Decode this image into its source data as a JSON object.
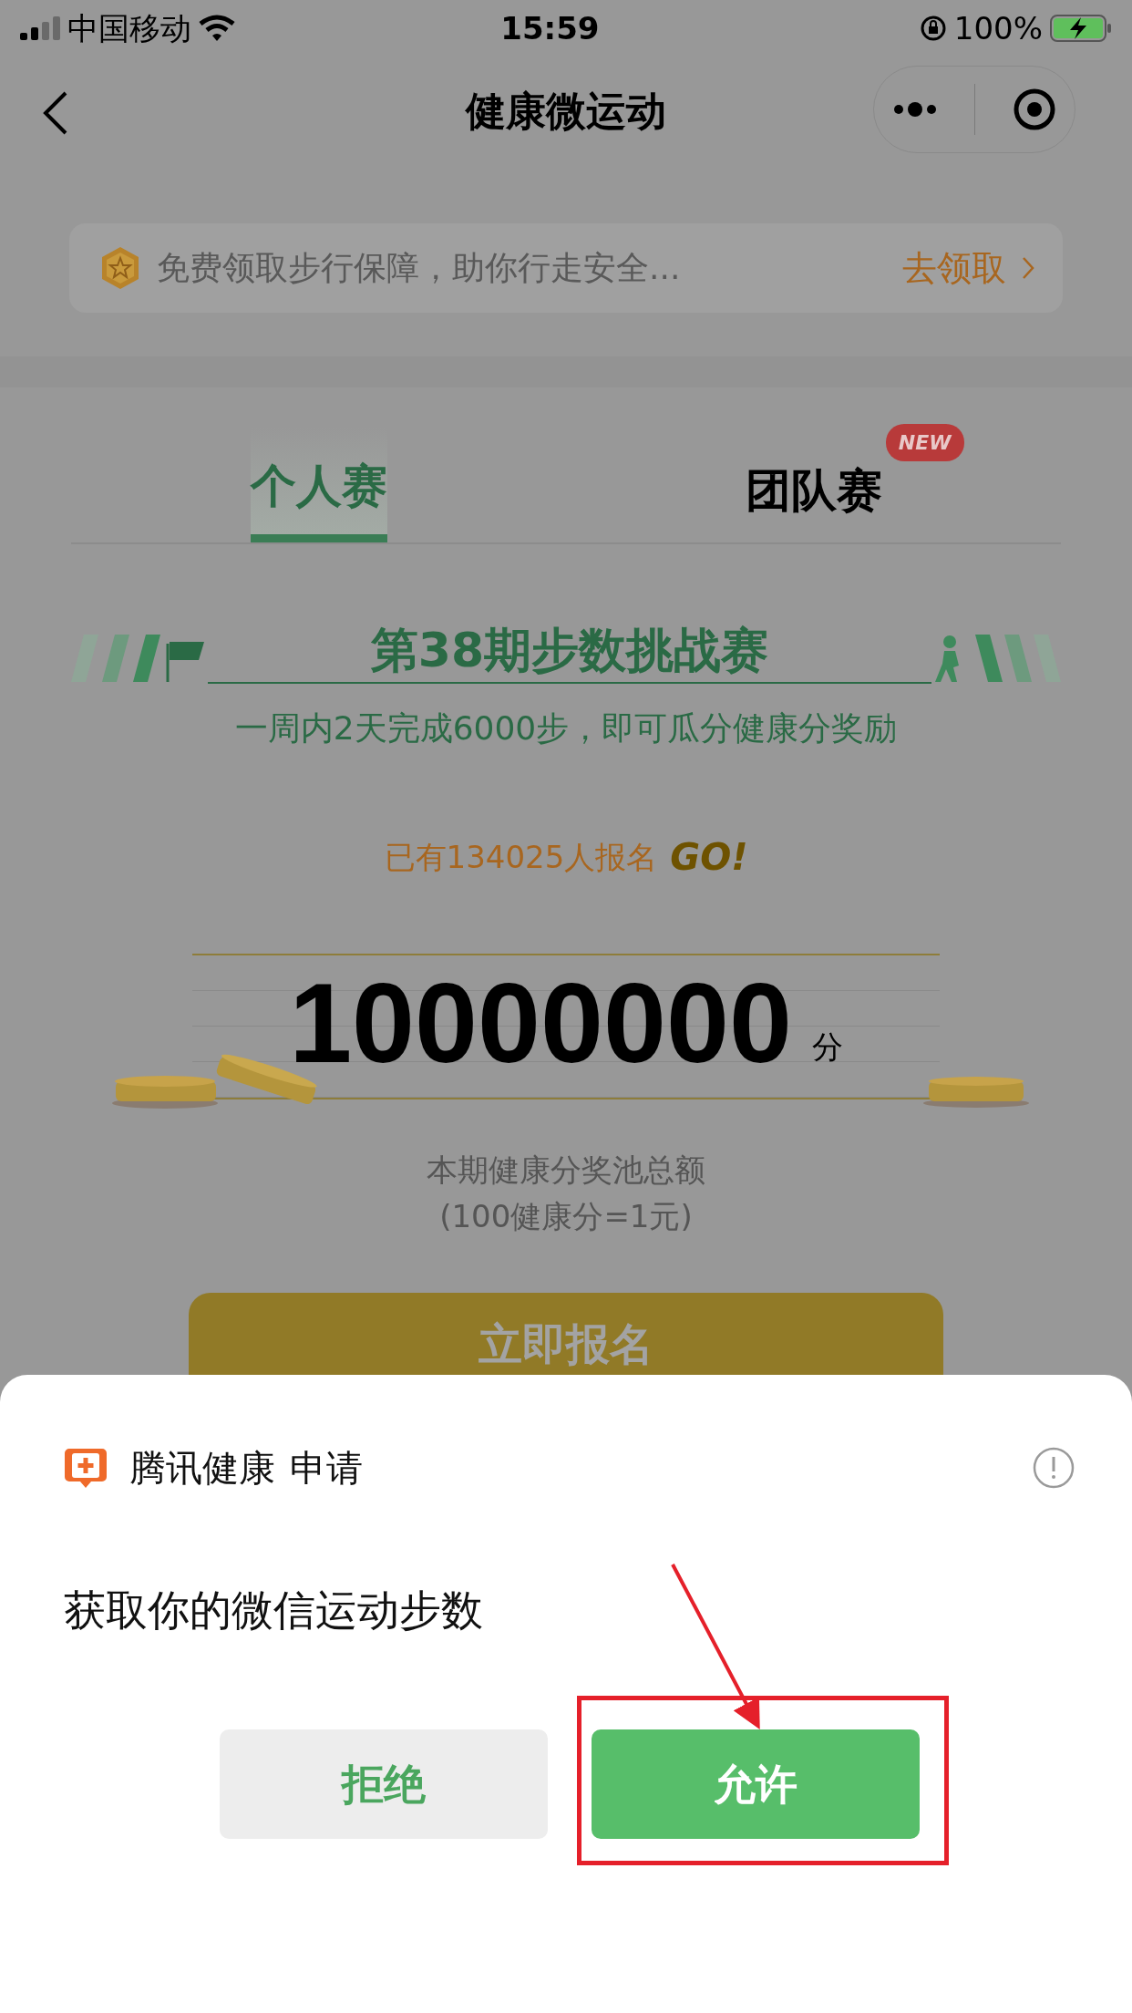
{
  "status_bar": {
    "carrier": "中国移动",
    "time": "15:59",
    "battery": "100%"
  },
  "nav": {
    "title": "健康微运动"
  },
  "banner": {
    "text": "免费领取步行保障，助你行走安全...",
    "action": "去领取"
  },
  "tabs": [
    {
      "label": "个人赛",
      "selected": true
    },
    {
      "label": "团队赛",
      "selected": false,
      "badge": "NEW"
    }
  ],
  "challenge": {
    "title": "第38期步数挑战赛",
    "subtitle": "一周内2天完成6000步，即可瓜分健康分奖励",
    "signups": "已有134025人报名",
    "go": "GO!",
    "prize": "10000000",
    "unit": "分",
    "caption": "本期健康分奖池总额",
    "rate": "(100健康分=1元)",
    "button": "立即报名"
  },
  "sheet": {
    "app": "腾讯健康",
    "verb": "申请",
    "request": "获取你的微信运动步数",
    "buttons": [
      {
        "label": "拒绝",
        "kind": "secondary"
      },
      {
        "label": "允许",
        "kind": "primary"
      }
    ]
  }
}
